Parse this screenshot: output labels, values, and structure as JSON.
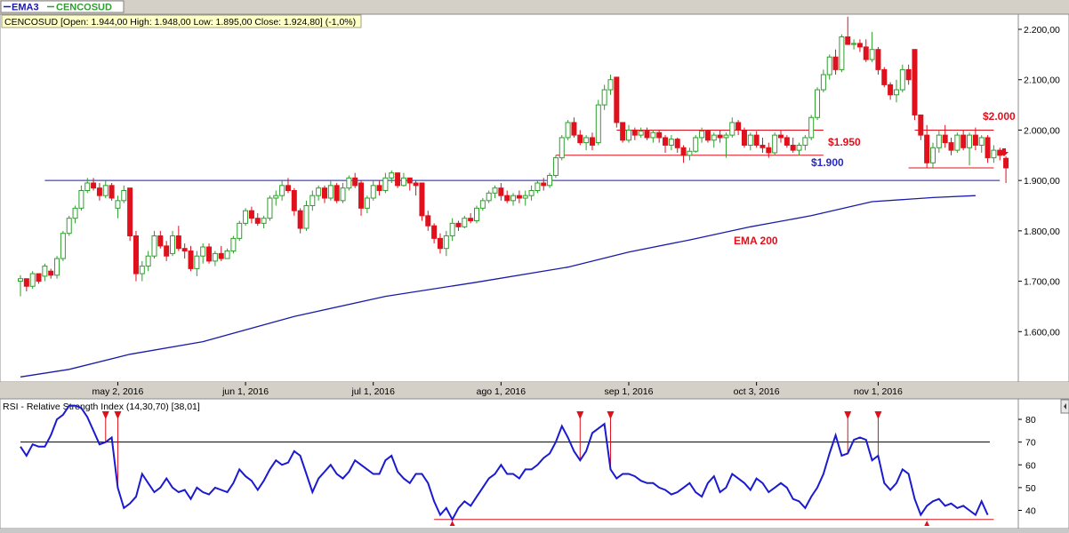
{
  "legend": {
    "ema_label": "EMA3",
    "stock_label": "CENCOSUD"
  },
  "colors": {
    "bull": "#2e9e2e",
    "bear": "#e0101c",
    "ema": "#1a1aa8",
    "rsi": "#1a1ad0",
    "annotation_red": "#e0101c",
    "annotation_blue": "#2828c8",
    "support": "#1a1ab0"
  },
  "price_panel": {
    "info_box": "CENCOSUD [Open: 1.944,00  High: 1.948,00  Low: 1.895,00  Close: 1.924,80] (-1,0%)",
    "y_ticks": [
      {
        "value": 1600,
        "label": "1.600,00"
      },
      {
        "value": 1700,
        "label": "1.700,00"
      },
      {
        "value": 1800,
        "label": "1.800,00"
      },
      {
        "value": 1900,
        "label": "1.900,00"
      },
      {
        "value": 2000,
        "label": "2.000,00"
      },
      {
        "value": 2100,
        "label": "2.100,00"
      },
      {
        "value": 2200,
        "label": "2.200,00"
      }
    ],
    "x_ticks": [
      {
        "session": 16,
        "label": "may 2, 2016"
      },
      {
        "session": 37,
        "label": "jun 1, 2016"
      },
      {
        "session": 58,
        "label": "jul 1, 2016"
      },
      {
        "session": 79,
        "label": "ago 1, 2016"
      },
      {
        "session": 100,
        "label": "sep 1, 2016"
      },
      {
        "session": 121,
        "label": "oct 3, 2016"
      },
      {
        "session": 141,
        "label": "nov 1, 2016"
      }
    ],
    "annotations": {
      "label_1950": "$1.950",
      "label_1900": "$1.900",
      "label_2000": "$2.000",
      "label_ema": "EMA 200"
    }
  },
  "rsi_panel": {
    "title": "RSI - Relative Strength Index (14,30,70) [38,01]",
    "y_ticks": [
      {
        "value": 40,
        "label": "40"
      },
      {
        "value": 50,
        "label": "50"
      },
      {
        "value": 60,
        "label": "60"
      },
      {
        "value": 70,
        "label": "70"
      },
      {
        "value": 80,
        "label": "80"
      }
    ],
    "arrow_glyph": "▲"
  },
  "chart_data": [
    {
      "type": "candlestick",
      "title": "CENCOSUD",
      "x_unit": "trading sessions",
      "ylim": [
        1500,
        2230
      ],
      "x_range": [
        0,
        158
      ],
      "candles": [
        [
          1700,
          1712,
          1670,
          1705
        ],
        [
          1705,
          1700,
          1680,
          1690
        ],
        [
          1690,
          1720,
          1685,
          1715
        ],
        [
          1715,
          1710,
          1695,
          1700
        ],
        [
          1710,
          1735,
          1700,
          1730
        ],
        [
          1720,
          1725,
          1705,
          1712
        ],
        [
          1712,
          1750,
          1705,
          1745
        ],
        [
          1745,
          1800,
          1740,
          1795
        ],
        [
          1795,
          1830,
          1790,
          1825
        ],
        [
          1825,
          1850,
          1815,
          1845
        ],
        [
          1845,
          1890,
          1840,
          1880
        ],
        [
          1880,
          1905,
          1875,
          1895
        ],
        [
          1895,
          1905,
          1880,
          1885
        ],
        [
          1885,
          1895,
          1860,
          1870
        ],
        [
          1870,
          1900,
          1865,
          1890
        ],
        [
          1890,
          1895,
          1860,
          1865
        ],
        [
          1845,
          1870,
          1825,
          1860
        ],
        [
          1860,
          1890,
          1855,
          1880
        ],
        [
          1885,
          1885,
          1780,
          1790
        ],
        [
          1790,
          1800,
          1700,
          1715
        ],
        [
          1715,
          1740,
          1700,
          1730
        ],
        [
          1730,
          1760,
          1720,
          1750
        ],
        [
          1750,
          1800,
          1745,
          1790
        ],
        [
          1790,
          1800,
          1765,
          1770
        ],
        [
          1770,
          1780,
          1740,
          1750
        ],
        [
          1755,
          1800,
          1750,
          1790
        ],
        [
          1790,
          1810,
          1760,
          1765
        ],
        [
          1765,
          1775,
          1745,
          1760
        ],
        [
          1760,
          1770,
          1720,
          1725
        ],
        [
          1725,
          1760,
          1710,
          1750
        ],
        [
          1750,
          1775,
          1735,
          1768
        ],
        [
          1768,
          1775,
          1735,
          1740
        ],
        [
          1740,
          1760,
          1730,
          1755
        ],
        [
          1755,
          1770,
          1740,
          1745
        ],
        [
          1745,
          1765,
          1745,
          1760
        ],
        [
          1760,
          1790,
          1755,
          1785
        ],
        [
          1785,
          1820,
          1780,
          1815
        ],
        [
          1815,
          1845,
          1810,
          1840
        ],
        [
          1840,
          1848,
          1815,
          1825
        ],
        [
          1825,
          1835,
          1810,
          1815
        ],
        [
          1815,
          1830,
          1805,
          1825
        ],
        [
          1825,
          1870,
          1820,
          1865
        ],
        [
          1865,
          1880,
          1850,
          1870
        ],
        [
          1870,
          1900,
          1860,
          1890
        ],
        [
          1890,
          1905,
          1875,
          1880
        ],
        [
          1880,
          1885,
          1830,
          1840
        ],
        [
          1840,
          1845,
          1795,
          1805
        ],
        [
          1805,
          1860,
          1800,
          1850
        ],
        [
          1850,
          1880,
          1840,
          1870
        ],
        [
          1870,
          1890,
          1860,
          1885
        ],
        [
          1885,
          1890,
          1855,
          1865
        ],
        [
          1865,
          1900,
          1860,
          1890
        ],
        [
          1890,
          1895,
          1855,
          1860
        ],
        [
          1860,
          1895,
          1855,
          1885
        ],
        [
          1885,
          1910,
          1880,
          1905
        ],
        [
          1905,
          1915,
          1885,
          1890
        ],
        [
          1895,
          1900,
          1830,
          1845
        ],
        [
          1845,
          1870,
          1835,
          1865
        ],
        [
          1865,
          1900,
          1860,
          1890
        ],
        [
          1890,
          1900,
          1870,
          1880
        ],
        [
          1880,
          1915,
          1875,
          1905
        ],
        [
          1905,
          1920,
          1895,
          1915
        ],
        [
          1915,
          1915,
          1885,
          1890
        ],
        [
          1890,
          1915,
          1888,
          1905
        ],
        [
          1905,
          1905,
          1880,
          1895
        ],
        [
          1895,
          1900,
          1870,
          1890
        ],
        [
          1895,
          1895,
          1820,
          1830
        ],
        [
          1830,
          1840,
          1800,
          1810
        ],
        [
          1810,
          1815,
          1775,
          1785
        ],
        [
          1785,
          1795,
          1755,
          1765
        ],
        [
          1765,
          1800,
          1750,
          1790
        ],
        [
          1790,
          1825,
          1780,
          1815
        ],
        [
          1815,
          1820,
          1800,
          1808
        ],
        [
          1808,
          1830,
          1805,
          1825
        ],
        [
          1825,
          1835,
          1815,
          1820
        ],
        [
          1820,
          1850,
          1815,
          1845
        ],
        [
          1845,
          1865,
          1840,
          1860
        ],
        [
          1860,
          1880,
          1855,
          1875
        ],
        [
          1875,
          1890,
          1865,
          1885
        ],
        [
          1885,
          1895,
          1860,
          1870
        ],
        [
          1870,
          1880,
          1855,
          1860
        ],
        [
          1860,
          1875,
          1850,
          1870
        ],
        [
          1870,
          1880,
          1855,
          1865
        ],
        [
          1865,
          1880,
          1850,
          1870
        ],
        [
          1870,
          1890,
          1860,
          1880
        ],
        [
          1880,
          1900,
          1875,
          1895
        ],
        [
          1895,
          1905,
          1880,
          1890
        ],
        [
          1890,
          1915,
          1885,
          1910
        ],
        [
          1910,
          1950,
          1905,
          1945
        ],
        [
          1945,
          1990,
          1940,
          1985
        ],
        [
          1985,
          2020,
          1980,
          2015
        ],
        [
          2015,
          2025,
          1985,
          1990
        ],
        [
          1990,
          2000,
          1970,
          1975
        ],
        [
          1975,
          1990,
          1960,
          1985
        ],
        [
          1985,
          1995,
          1960,
          1970
        ],
        [
          1975,
          2060,
          1970,
          2050
        ],
        [
          2050,
          2090,
          2040,
          2080
        ],
        [
          2080,
          2110,
          2070,
          2100
        ],
        [
          2105,
          2105,
          2005,
          2015
        ],
        [
          2015,
          2015,
          1975,
          1980
        ],
        [
          1980,
          2010,
          1975,
          2000
        ],
        [
          2000,
          2005,
          1980,
          1990
        ],
        [
          1990,
          2005,
          1985,
          1998
        ],
        [
          1998,
          2005,
          1980,
          1985
        ],
        [
          1985,
          2000,
          1975,
          1995
        ],
        [
          1995,
          2000,
          1975,
          1985
        ],
        [
          1985,
          1990,
          1955,
          1970
        ],
        [
          1970,
          1990,
          1960,
          1982
        ],
        [
          1982,
          1985,
          1955,
          1965
        ],
        [
          1965,
          1970,
          1935,
          1950
        ],
        [
          1950,
          1965,
          1940,
          1958
        ],
        [
          1958,
          1990,
          1955,
          1985
        ],
        [
          1985,
          2005,
          1975,
          1998
        ],
        [
          1998,
          2000,
          1975,
          1980
        ],
        [
          1980,
          1995,
          1965,
          1990
        ],
        [
          1990,
          2000,
          1975,
          1985
        ],
        [
          1985,
          1995,
          1945,
          1990
        ],
        [
          1990,
          2025,
          1985,
          2015
        ],
        [
          2015,
          2020,
          1990,
          2000
        ],
        [
          2000,
          2005,
          1965,
          1970
        ],
        [
          1970,
          1995,
          1960,
          1990
        ],
        [
          1990,
          1998,
          1965,
          1970
        ],
        [
          1970,
          1985,
          1955,
          1965
        ],
        [
          1965,
          1975,
          1945,
          1955
        ],
        [
          1955,
          1995,
          1950,
          1990
        ],
        [
          1990,
          2000,
          1975,
          1985
        ],
        [
          1985,
          1990,
          1965,
          1970
        ],
        [
          1970,
          1985,
          1955,
          1960
        ],
        [
          1960,
          1975,
          1950,
          1970
        ],
        [
          1970,
          1990,
          1960,
          1985
        ],
        [
          1985,
          2030,
          1980,
          2025
        ],
        [
          2025,
          2085,
          2020,
          2080
        ],
        [
          2080,
          2120,
          2075,
          2110
        ],
        [
          2110,
          2150,
          2100,
          2145
        ],
        [
          2145,
          2160,
          2110,
          2120
        ],
        [
          2120,
          2190,
          2115,
          2185
        ],
        [
          2185,
          2225,
          2170,
          2170
        ],
        [
          2170,
          2180,
          2160,
          2172
        ],
        [
          2172,
          2180,
          2155,
          2165
        ],
        [
          2165,
          2180,
          2135,
          2140
        ],
        [
          2140,
          2195,
          2135,
          2160
        ],
        [
          2160,
          2165,
          2110,
          2120
        ],
        [
          2120,
          2125,
          2085,
          2090
        ],
        [
          2090,
          2095,
          2060,
          2070
        ],
        [
          2070,
          2100,
          2055,
          2080
        ],
        [
          2080,
          2130,
          2075,
          2120
        ],
        [
          2120,
          2130,
          2090,
          2100
        ],
        [
          2160,
          2160,
          2020,
          2030
        ],
        [
          2030,
          2030,
          1980,
          1990
        ],
        [
          1990,
          2010,
          1925,
          1935
        ],
        [
          1935,
          1975,
          1925,
          1965
        ],
        [
          1965,
          2000,
          1955,
          1990
        ],
        [
          1990,
          2010,
          1965,
          1975
        ],
        [
          1975,
          1985,
          1950,
          1960
        ],
        [
          1960,
          1995,
          1955,
          1990
        ],
        [
          1990,
          2000,
          1960,
          1965
        ],
        [
          1965,
          1995,
          1930,
          1990
        ],
        [
          1990,
          2005,
          1960,
          1970
        ],
        [
          1970,
          1990,
          1955,
          1985
        ],
        [
          1985,
          1990,
          1935,
          1945
        ],
        [
          1945,
          1970,
          1935,
          1960
        ],
        [
          1960,
          1965,
          1940,
          1950
        ],
        [
          1944,
          1948,
          1895,
          1925
        ]
      ]
    },
    {
      "type": "line",
      "title": "EMA 200",
      "x": [
        0,
        8,
        18,
        30,
        45,
        60,
        75,
        90,
        100,
        110,
        120,
        130,
        140,
        150,
        157
      ],
      "y": [
        1510,
        1525,
        1555,
        1580,
        1630,
        1670,
        1698,
        1728,
        1758,
        1782,
        1808,
        1830,
        1858,
        1866,
        1870
      ]
    },
    {
      "type": "line",
      "title": "RSI - Relative Strength Index (14,30,70)",
      "ylim": [
        32,
        89
      ],
      "values": [
        68,
        64,
        69,
        68,
        68,
        73,
        80,
        82,
        86,
        86,
        85,
        81,
        75,
        69,
        70,
        72,
        50,
        41,
        43,
        46,
        56,
        52,
        48,
        50,
        54,
        50,
        48,
        49,
        45,
        50,
        48,
        47,
        50,
        49,
        48,
        52,
        58,
        55,
        53,
        49,
        53,
        58,
        62,
        60,
        61,
        66,
        64,
        56,
        48,
        54,
        57,
        60,
        56,
        54,
        57,
        62,
        60,
        58,
        56,
        56,
        62,
        64,
        57,
        54,
        52,
        56,
        56,
        52,
        44,
        38,
        41,
        36,
        41,
        44,
        42,
        46,
        50,
        54,
        56,
        60,
        56,
        56,
        54,
        58,
        58,
        60,
        63,
        65,
        70,
        77,
        72,
        66,
        62,
        66,
        74,
        76,
        78,
        58,
        54,
        56,
        56,
        55,
        53,
        52,
        52,
        50,
        49,
        47,
        48,
        50,
        52,
        48,
        46,
        52,
        55,
        48,
        50,
        56,
        54,
        52,
        49,
        54,
        52,
        48,
        50,
        52,
        50,
        45,
        44,
        41,
        46,
        50,
        56,
        65,
        73,
        64,
        65,
        71,
        72,
        71,
        62,
        64,
        52,
        49,
        52,
        58,
        56,
        45,
        38,
        42,
        44,
        45,
        42,
        43,
        41,
        42,
        40,
        38,
        44,
        38
      ],
      "overbought": 70,
      "oversold": 30,
      "sell_signals_at": [
        14,
        16,
        92,
        97,
        136,
        141
      ],
      "buy_signals_at": [
        71,
        149
      ]
    }
  ]
}
